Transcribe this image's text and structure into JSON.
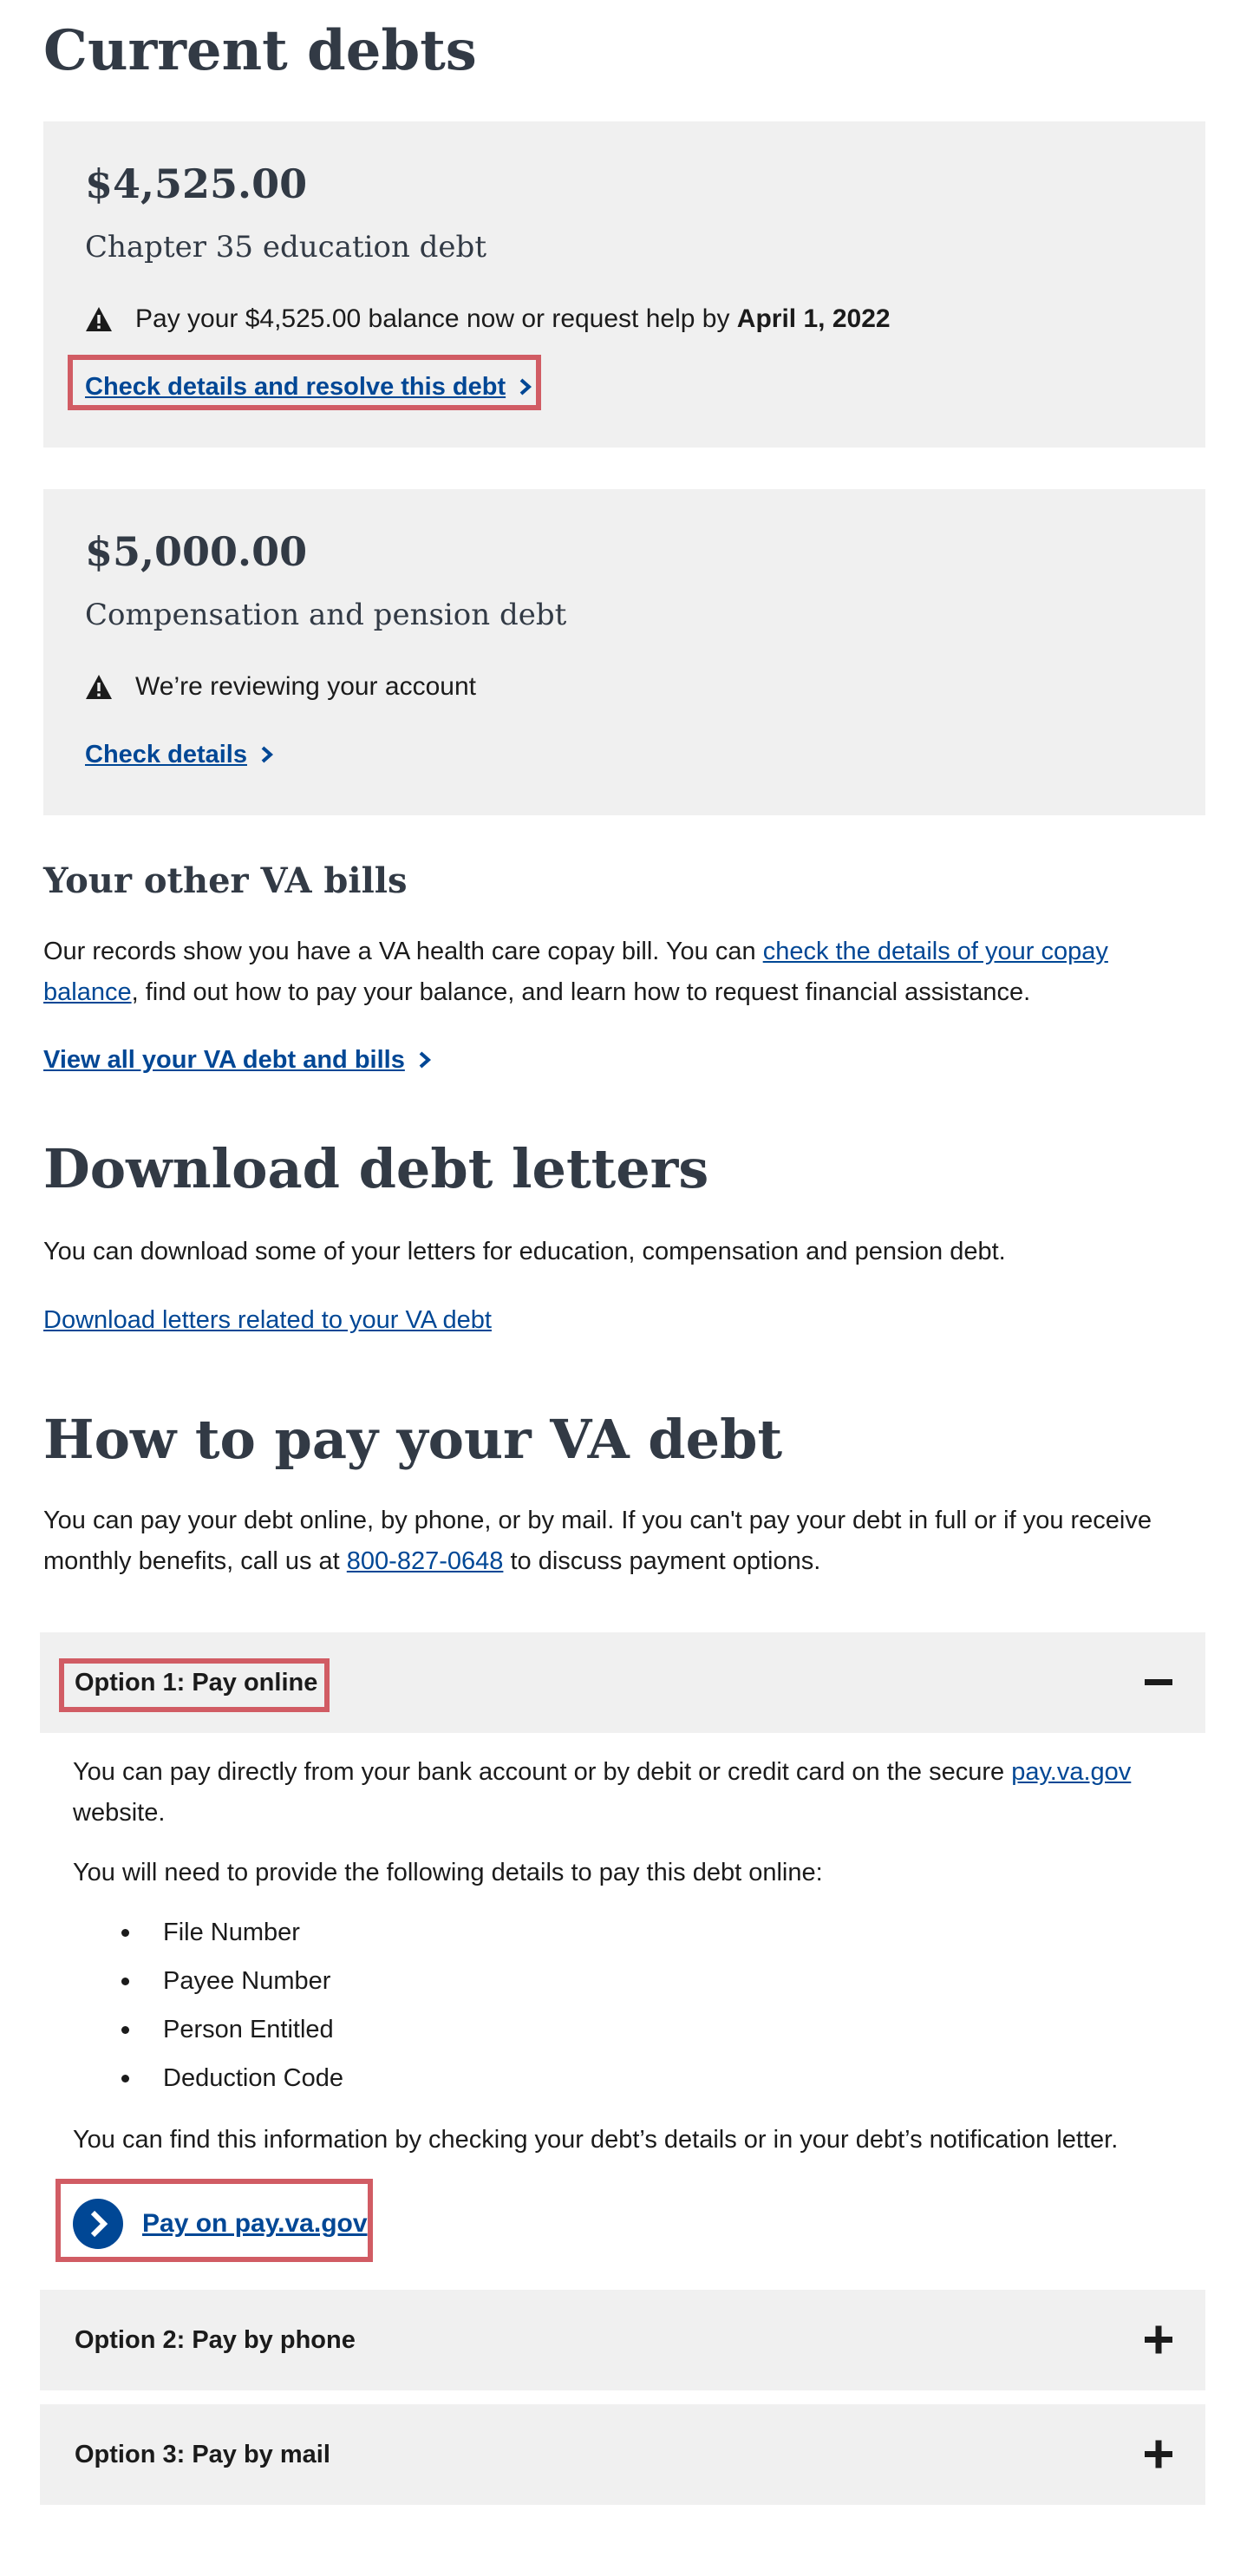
{
  "page": {
    "title": "Current debts"
  },
  "debts": [
    {
      "amount": "$4,525.00",
      "type": "Chapter 35 education debt",
      "status_prefix": "Pay your $4,525.00 balance now or request help by ",
      "status_date": "April 1, 2022",
      "link_label": "Check details and resolve this debt"
    },
    {
      "amount": "$5,000.00",
      "type": "Compensation and pension debt",
      "status_prefix": "We’re reviewing your account",
      "status_date": "",
      "link_label": "Check details"
    }
  ],
  "other_bills": {
    "heading": "Your other VA bills",
    "text_before": "Our records show you have a VA health care copay bill. You can ",
    "link_text": "check the details of your copay balance",
    "text_after": ", find out how to pay your balance, and learn how to request financial assistance.",
    "view_all_label": "View all your VA debt and bills"
  },
  "letters": {
    "heading": "Download debt letters",
    "text": "You can download some of your letters for education, compensation and pension debt.",
    "link_label": "Download letters related to your VA debt"
  },
  "how_to_pay": {
    "heading": "How to pay your VA debt",
    "text_before": "You can pay your debt online, by phone, or by mail. If you can't pay your debt in full or if you receive monthly benefits, call us at ",
    "phone": "800-827-0648",
    "text_after": " to discuss payment options."
  },
  "options": [
    {
      "label": "Option 1: Pay online",
      "expanded": true,
      "intro_before": "You can pay directly from your bank account or by debit or credit card on the secure ",
      "intro_link": "pay.va.gov",
      "intro_after": " website.",
      "details_intro": "You will need to provide the following details to pay this debt online:",
      "details": [
        "File Number",
        "Payee Number",
        "Person Entitled",
        "Deduction Code"
      ],
      "find_info": "You can find this information by checking your debt’s details or in your debt’s notification letter.",
      "pay_link_label": "Pay on pay.va.gov"
    },
    {
      "label": "Option 2: Pay by phone",
      "expanded": false
    },
    {
      "label": "Option 3: Pay by mail",
      "expanded": false
    }
  ],
  "colors": {
    "link": "#004795",
    "card_bg": "#f0f0f0",
    "heading": "#323a45",
    "highlight": "#d15c64"
  },
  "icons": {
    "warning": "warning-triangle-icon",
    "chevron": "chevron-right-icon",
    "collapse": "minus-icon",
    "expand": "plus-icon",
    "pay_circle": "circle-chevron-right-icon"
  }
}
